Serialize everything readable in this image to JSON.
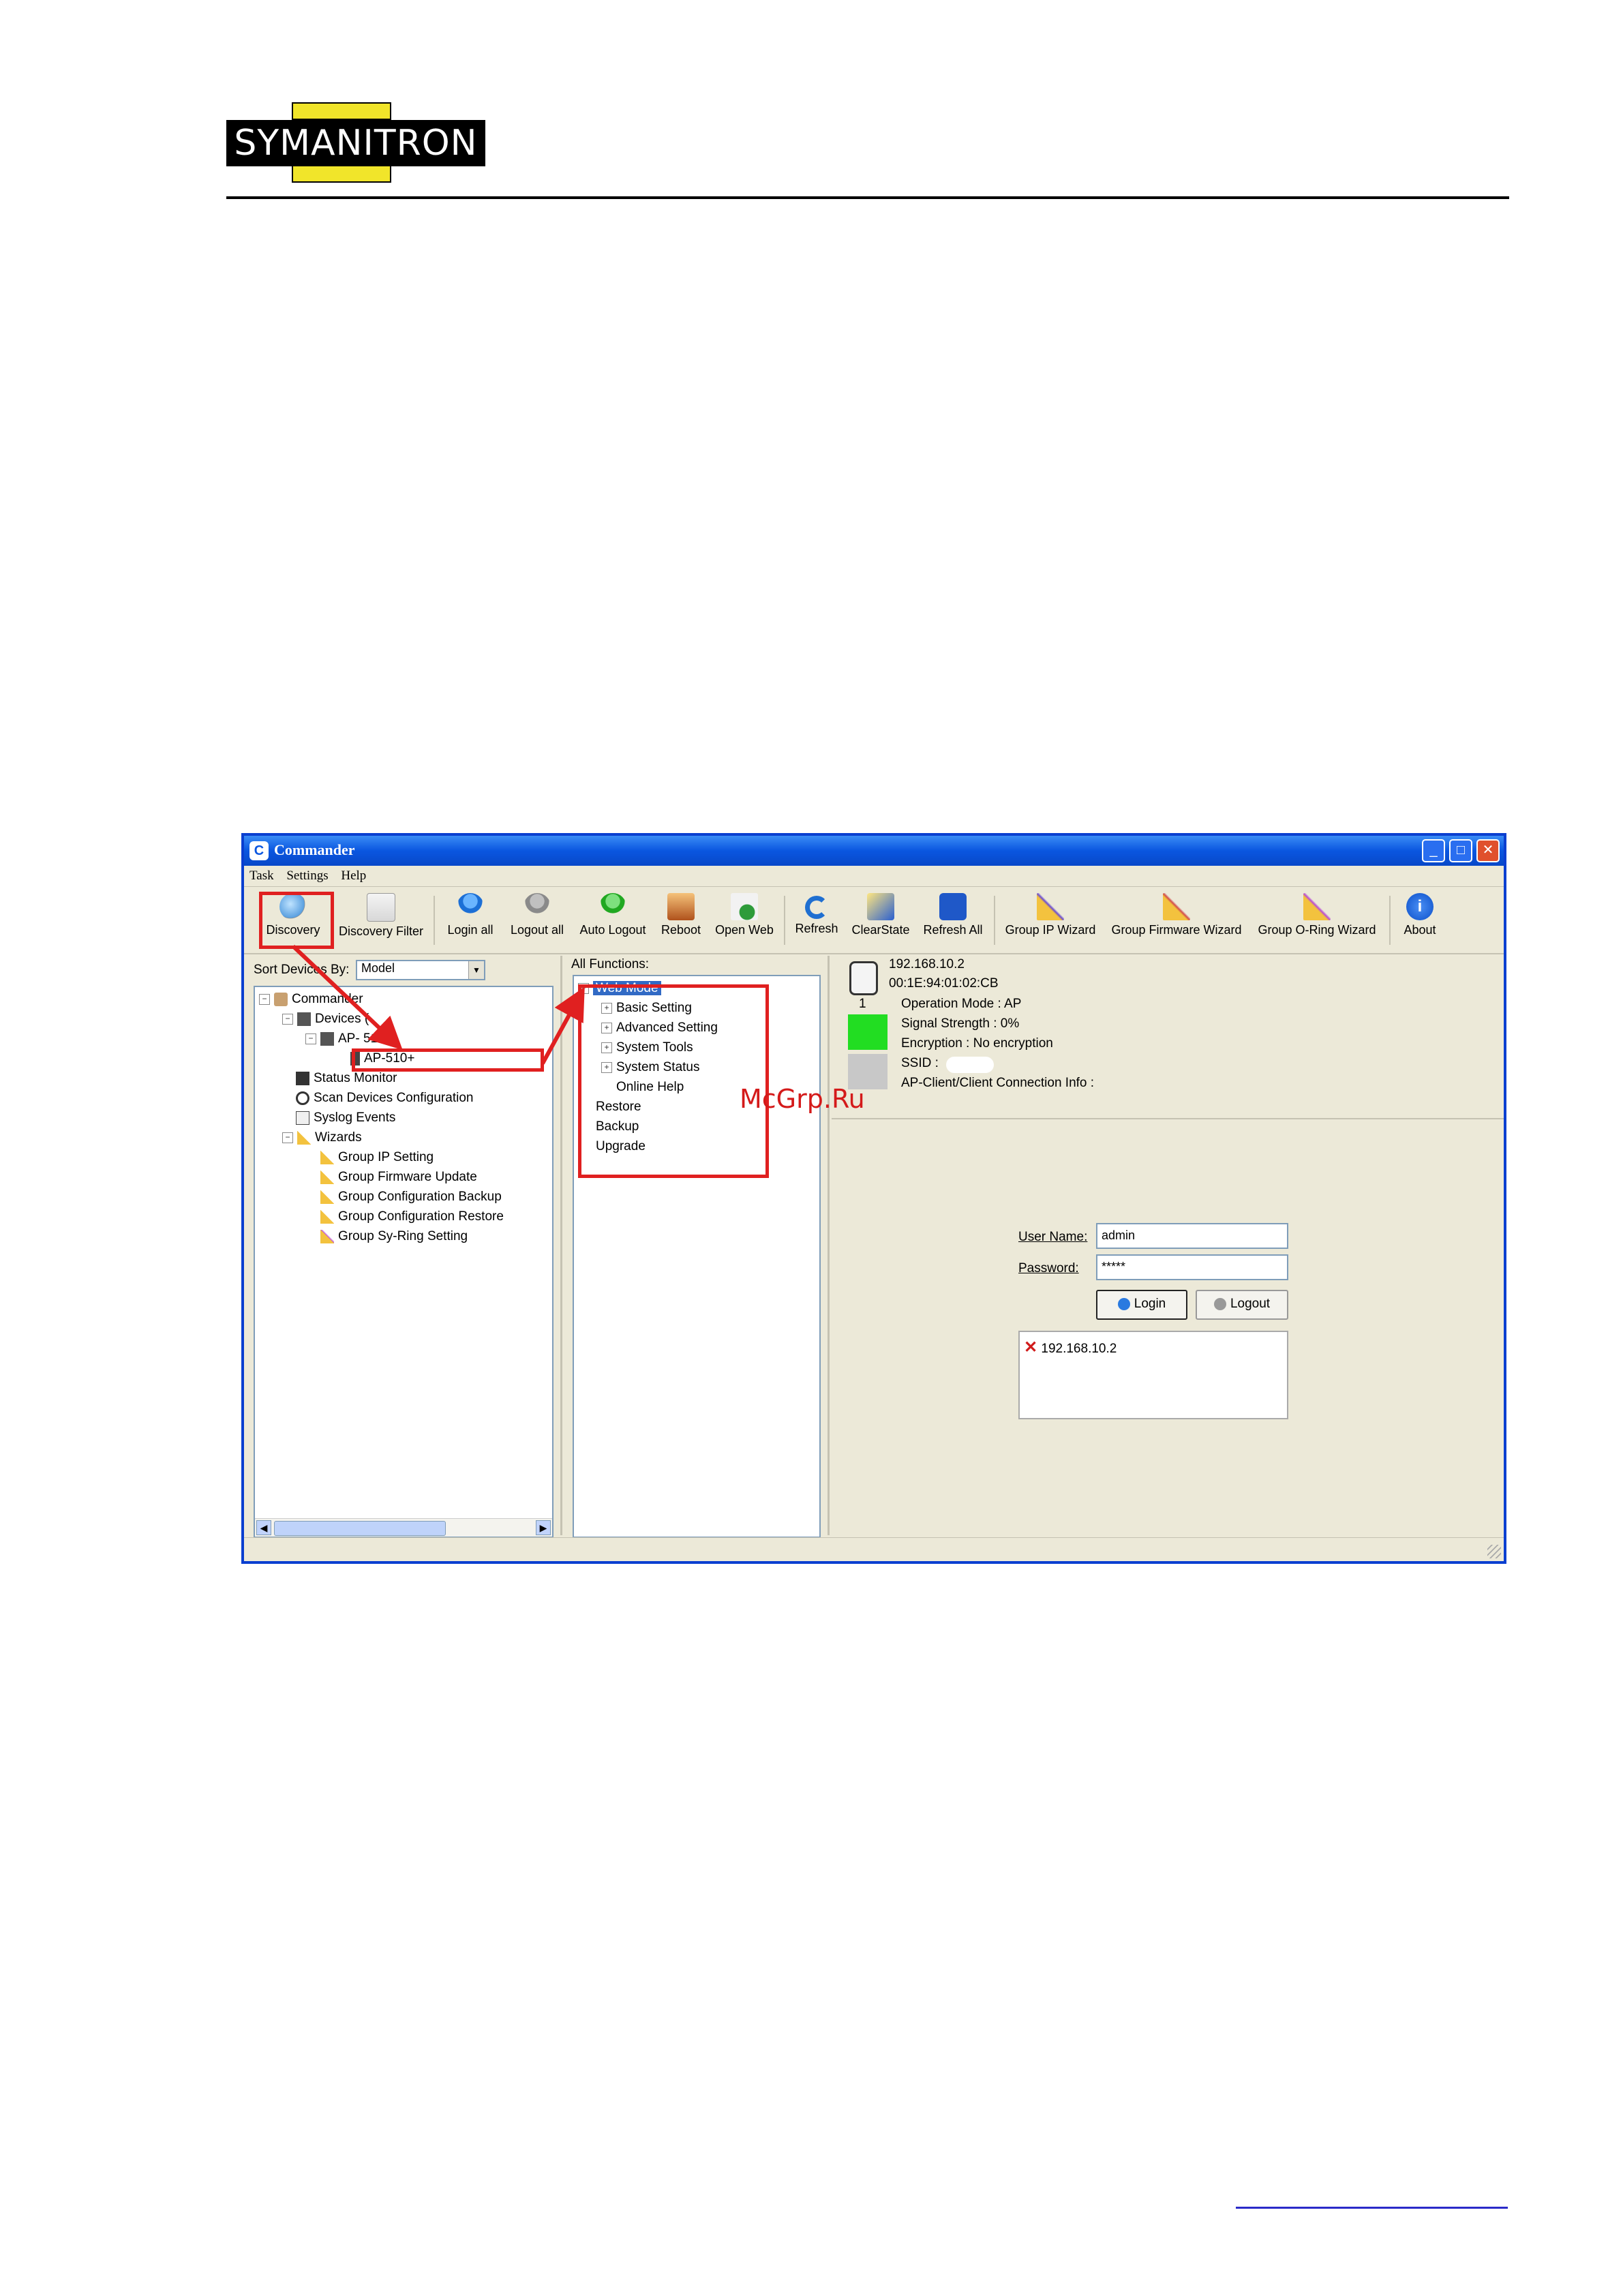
{
  "page": {
    "logo_text": "SYMANITRON",
    "watermark": "McGrp.Ru"
  },
  "window": {
    "title": "Commander",
    "menu": [
      "Task",
      "Settings",
      "Help"
    ],
    "toolbar": [
      {
        "label": "Discovery",
        "icon": "magnifier-icon"
      },
      {
        "label": "Discovery Filter",
        "icon": "filter-magnifier-icon"
      },
      {
        "label": "Login all",
        "icon": "user-login-icon"
      },
      {
        "label": "Logout all",
        "icon": "user-logout-icon"
      },
      {
        "label": "Auto Logout",
        "icon": "user-auto-logout-icon"
      },
      {
        "label": "Reboot",
        "icon": "reboot-icon"
      },
      {
        "label": "Open Web",
        "icon": "globe-page-icon"
      },
      {
        "label": "Refresh",
        "icon": "refresh-icon"
      },
      {
        "label": "ClearState",
        "icon": "clear-state-icon"
      },
      {
        "label": "Refresh All",
        "icon": "refresh-all-icon"
      },
      {
        "label": "Group IP Wizard",
        "icon": "wand-icon"
      },
      {
        "label": "Group Firmware Wizard",
        "icon": "wand-icon"
      },
      {
        "label": "Group O-Ring Wizard",
        "icon": "wand-icon"
      },
      {
        "label": "About",
        "icon": "info-icon"
      }
    ],
    "left": {
      "sort_label": "Sort Devices By:",
      "sort_value": "Model",
      "tree": [
        "Commander",
        "Devices (",
        "AP- 510",
        "AP-510+",
        "Status Monitor",
        "Scan Devices Configuration",
        "Syslog Events",
        "Wizards",
        "Group IP Setting",
        "Group Firmware Update",
        "Group Configuration Backup",
        "Group Configuration Restore",
        "Group Sy-Ring Setting"
      ]
    },
    "middle": {
      "header": "All Functions:",
      "tree": [
        "Web Mode",
        "Basic Setting",
        "Advanced Setting",
        "System Tools",
        "System Status",
        "Online Help",
        "Restore",
        "Backup",
        "Upgrade"
      ]
    },
    "right": {
      "ip": "192.168.10.2",
      "mac": "00:1E:94:01:02:CB",
      "port_number": "1",
      "operation_mode": "Operation Mode :  AP",
      "signal": "Signal Strength :  0%",
      "encryption": "Encryption :  No encryption",
      "ssid": "SSID :",
      "client_info": "AP-Client/Client Connection Info :",
      "username_label": "User Name:",
      "username_value": "admin",
      "password_label": "Password:",
      "password_value": "*****",
      "login_btn": "Login",
      "logout_btn": "Logout",
      "log_entry": "192.168.10.2"
    }
  },
  "colors": {
    "accent_red": "#e02020",
    "titlebar_blue": "#0a56e0",
    "port_green": "#22dd22"
  }
}
